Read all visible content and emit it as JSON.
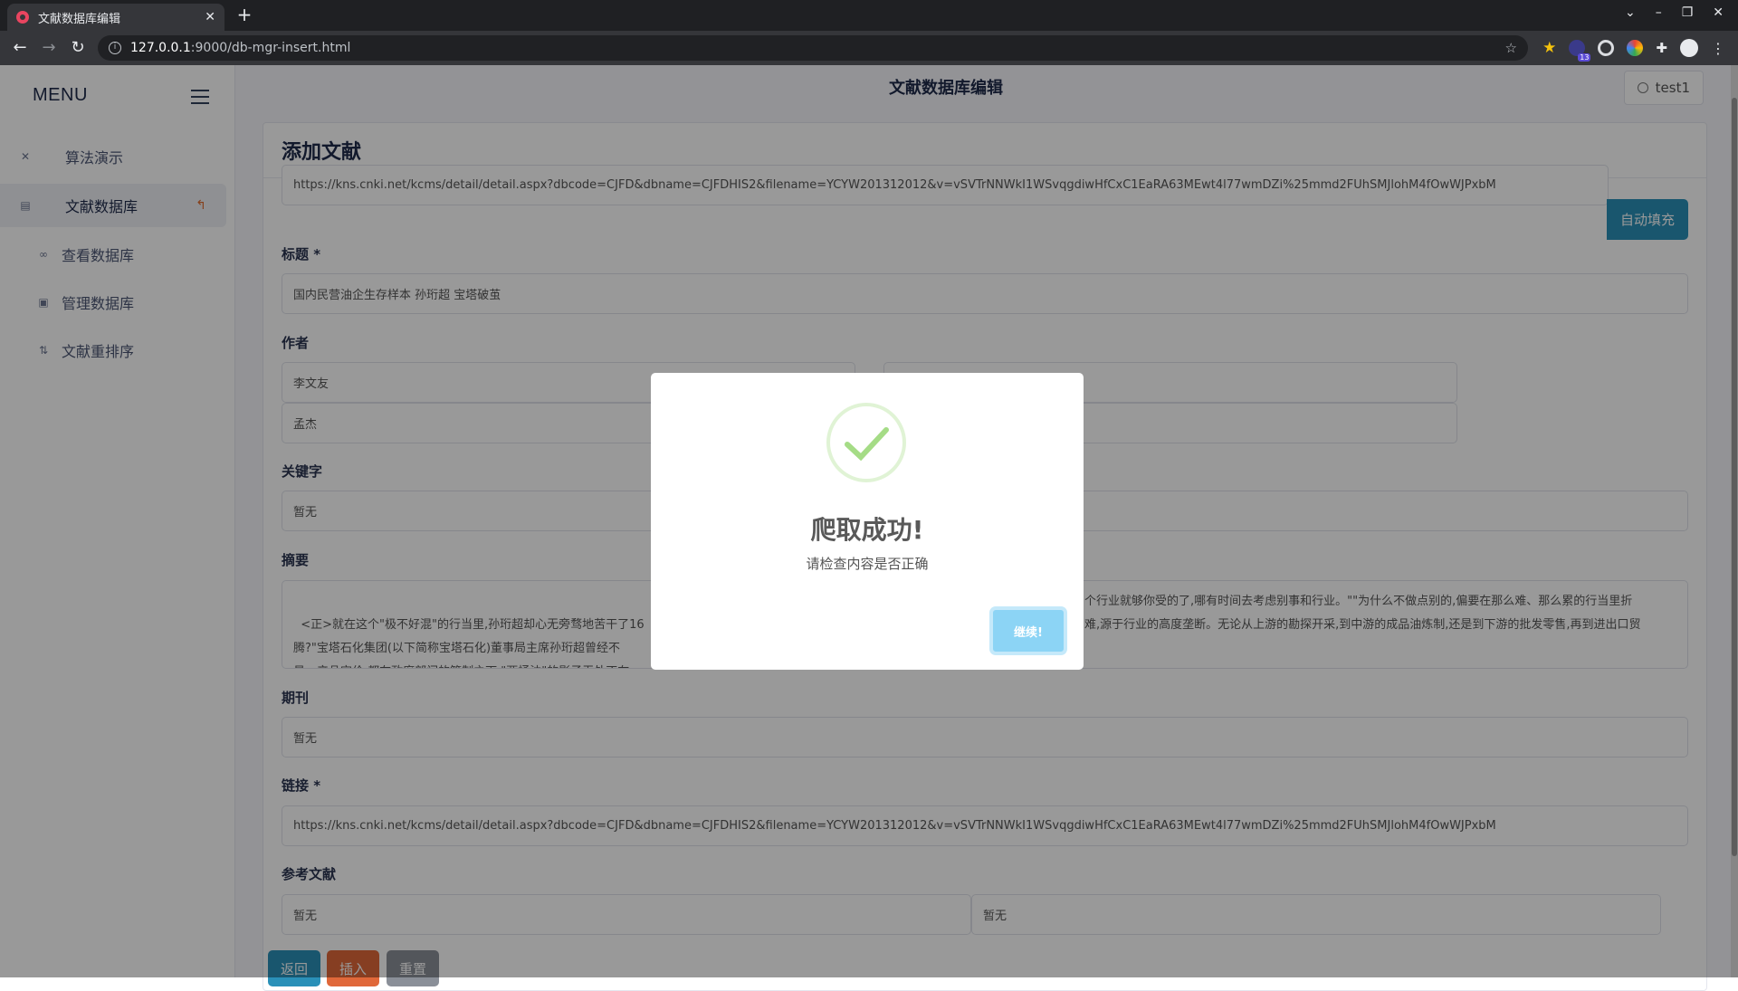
{
  "browser": {
    "tab_title": "文献数据库编辑",
    "tab_close": "✕",
    "new_tab": "+",
    "url_host": "127.0.0.1",
    "url_rest": ":9000/db-mgr-insert.html",
    "extension_badge": "13"
  },
  "sidebar": {
    "menu_title": "MENU",
    "items": [
      {
        "label": "算法演示",
        "icon": "tools-icon"
      },
      {
        "label": "文献数据库",
        "icon": "list-icon",
        "arrow": "↰"
      },
      {
        "label": "查看数据库",
        "icon": "glasses-icon"
      },
      {
        "label": "管理数据库",
        "icon": "database-icon"
      },
      {
        "label": "文献重排序",
        "icon": "sort-icon"
      }
    ]
  },
  "header": {
    "title": "文献数据库编辑",
    "user": "test1"
  },
  "form": {
    "card_title": "添加文献",
    "url_value": "https://kns.cnki.net/kcms/detail/detail.aspx?dbcode=CJFD&dbname=CJFDHIS2&filename=YCYW201312012&v=vSVTrNNWkI1WSvqgdiwHfCxC1EaRA63MEwt4l77wmDZi%25mmd2FUhSMJlohM4fOwWJPxbM",
    "autofill_label": "自动填充",
    "title_label": "标题 *",
    "title_value": "国内民营油企生存样本 孙珩超 宝塔破茧",
    "author_label": "作者",
    "authors": [
      "李文友",
      "孟杰"
    ],
    "keywords_label": "关键字",
    "keywords_value": "暂无",
    "abstract_label": "摘要",
    "abstract_left": "<正>就在这个\"极不好混\"的行当里,孙珩超却心无旁骛地苦干了16\n腾?\"宝塔石化集团(以下简称宝塔石化)董事局主席孙珩超曾经不\n易、产品定价,都在政府部门的管制之下,\"两桶油\"的影子无处不在,",
    "abstract_right_1": "个行业就够你受的了,哪有时间去考虑别事和行业。\"\"为什么不做点别的,偏要在那么难、那么累的行当里折",
    "abstract_right_2": "难,源于行业的高度垄断。无论从上游的勘探开采,到中游的成品油炼制,还是到下游的批发零售,再到进出口贸",
    "journal_label": "期刊",
    "journal_value": "暂无",
    "link_label": "链接 *",
    "link_value": "https://kns.cnki.net/kcms/detail/detail.aspx?dbcode=CJFD&dbname=CJFDHIS2&filename=YCYW201312012&v=vSVTrNNWkI1WSvqgdiwHfCxC1EaRA63MEwt4l77wmDZi%25mmd2FUhSMJlohM4fOwWJPxbM",
    "refs_label": "参考文献",
    "refs": [
      "暂无",
      "暂无"
    ],
    "buttons": {
      "back": "返回",
      "insert": "插入",
      "reset": "重置"
    }
  },
  "modal": {
    "title": "爬取成功!",
    "text": "请检查内容是否正确",
    "confirm": "继续!"
  },
  "colors": {
    "sidebar_active_arrow": "#e06b2e",
    "autofill": "#2a90b8",
    "back": "#2a90b8",
    "insert": "#e0683a",
    "reset": "#8a8f98",
    "success": "#a5dc86",
    "confirm": "#8cd4f5"
  }
}
